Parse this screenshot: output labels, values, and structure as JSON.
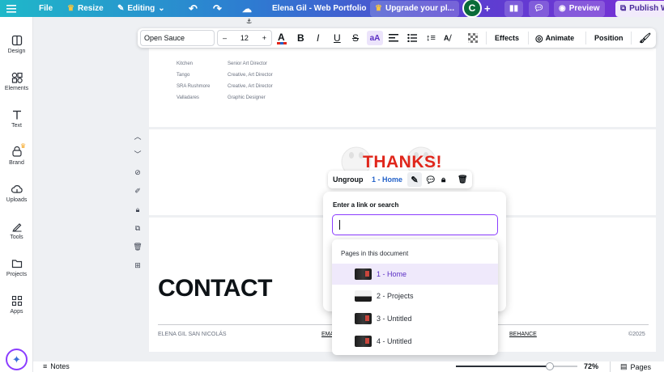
{
  "topbar": {
    "file": "File",
    "resize": "Resize",
    "editing": "Editing",
    "doc_title": "Elena Gil - Web Portfolio",
    "upgrade": "Upgrade your pl...",
    "avatar_letter": "C",
    "preview": "Preview",
    "publish": "Publish W"
  },
  "sidebar": {
    "items": [
      {
        "label": "Design",
        "icon": "layout-icon"
      },
      {
        "label": "Elements",
        "icon": "shapes-icon"
      },
      {
        "label": "Text",
        "icon": "text-icon"
      },
      {
        "label": "Brand",
        "icon": "brand-icon"
      },
      {
        "label": "Uploads",
        "icon": "cloud-upload-icon"
      },
      {
        "label": "Tools",
        "icon": "pen-icon"
      },
      {
        "label": "Projects",
        "icon": "folder-icon"
      },
      {
        "label": "Apps",
        "icon": "apps-icon"
      }
    ]
  },
  "toolbar": {
    "font": "Open Sauce",
    "minus": "–",
    "size": "12",
    "plus": "+",
    "effects": "Effects",
    "animate": "Animate",
    "position": "Position"
  },
  "table_rows": [
    {
      "name": "Kitchen",
      "role": "Senior Art Director"
    },
    {
      "name": "Tango",
      "role": "Creative, Art Director"
    },
    {
      "name": "SRA Rushmore",
      "role": "Creative, Art Director"
    },
    {
      "name": "Valladares",
      "role": "Graphic Designer"
    }
  ],
  "thanks": "THANKS!",
  "context_menu": {
    "ungroup": "Ungroup",
    "link": "1 - Home"
  },
  "link_popup": {
    "title": "Enter a link or search",
    "input_value": "",
    "section_title": "Pages in this document",
    "pages": [
      "1 - Home",
      "2 - Projects",
      "3 - Untitled",
      "4 - Untitled"
    ]
  },
  "contact": {
    "heading": "CONTACT",
    "name": "ELENA GIL SAN NICOLÁS",
    "email_partial": "EMA",
    "behance": "BEHANCE",
    "copyright": "©2025"
  },
  "bottombar": {
    "notes": "Notes",
    "zoom": "72%",
    "pages": "Pages",
    "zoom_level": 0.72
  },
  "colors": {
    "accent": "#8b3dff",
    "thanks_red": "#e0261b",
    "link_blue": "#2563c9",
    "selected_row": "#efe9fb"
  }
}
